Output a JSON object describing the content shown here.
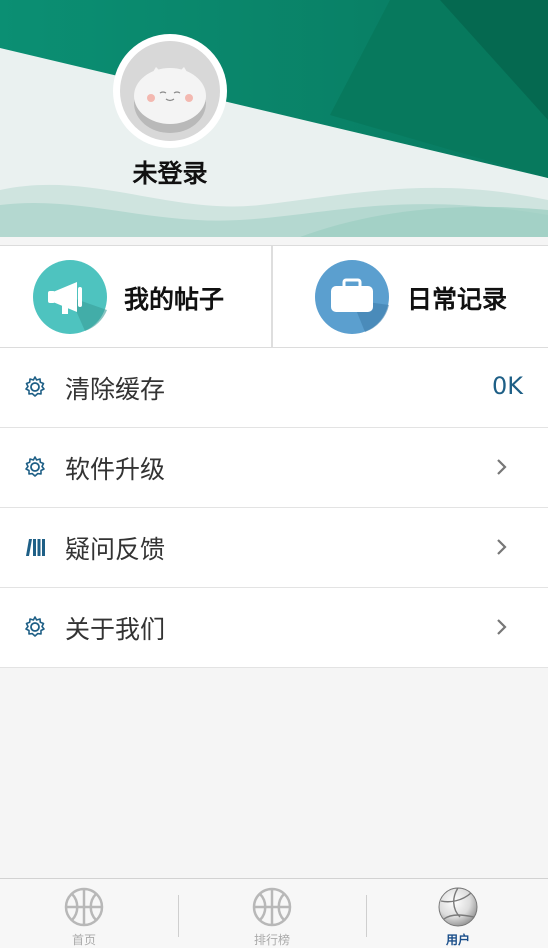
{
  "profile": {
    "login_status": "未登录"
  },
  "quick_actions": [
    {
      "label": "我的帖子",
      "icon": "megaphone-icon",
      "color": "#4ec3bf"
    },
    {
      "label": "日常记录",
      "icon": "briefcase-icon",
      "color": "#5b9fcf"
    }
  ],
  "menu": {
    "clear_cache": {
      "label": "清除缓存",
      "value": "0K",
      "icon": "gear-icon"
    },
    "software_upgrade": {
      "label": "软件升级",
      "icon": "gear-icon"
    },
    "feedback": {
      "label": "疑问反馈",
      "icon": "books-icon"
    },
    "about_us": {
      "label": "关于我们",
      "icon": "gear-icon"
    }
  },
  "tabs": [
    {
      "label": "首页",
      "icon": "basketball-icon",
      "active": false
    },
    {
      "label": "排行榜",
      "icon": "basketball-icon",
      "active": false
    },
    {
      "label": "用户",
      "icon": "volleyball-icon",
      "active": true
    }
  ],
  "colors": {
    "header_green": "#0a8a6c",
    "header_dark_green": "#06664f",
    "accent_blue": "#1e5f86",
    "active_tab": "#1a4e8a"
  }
}
